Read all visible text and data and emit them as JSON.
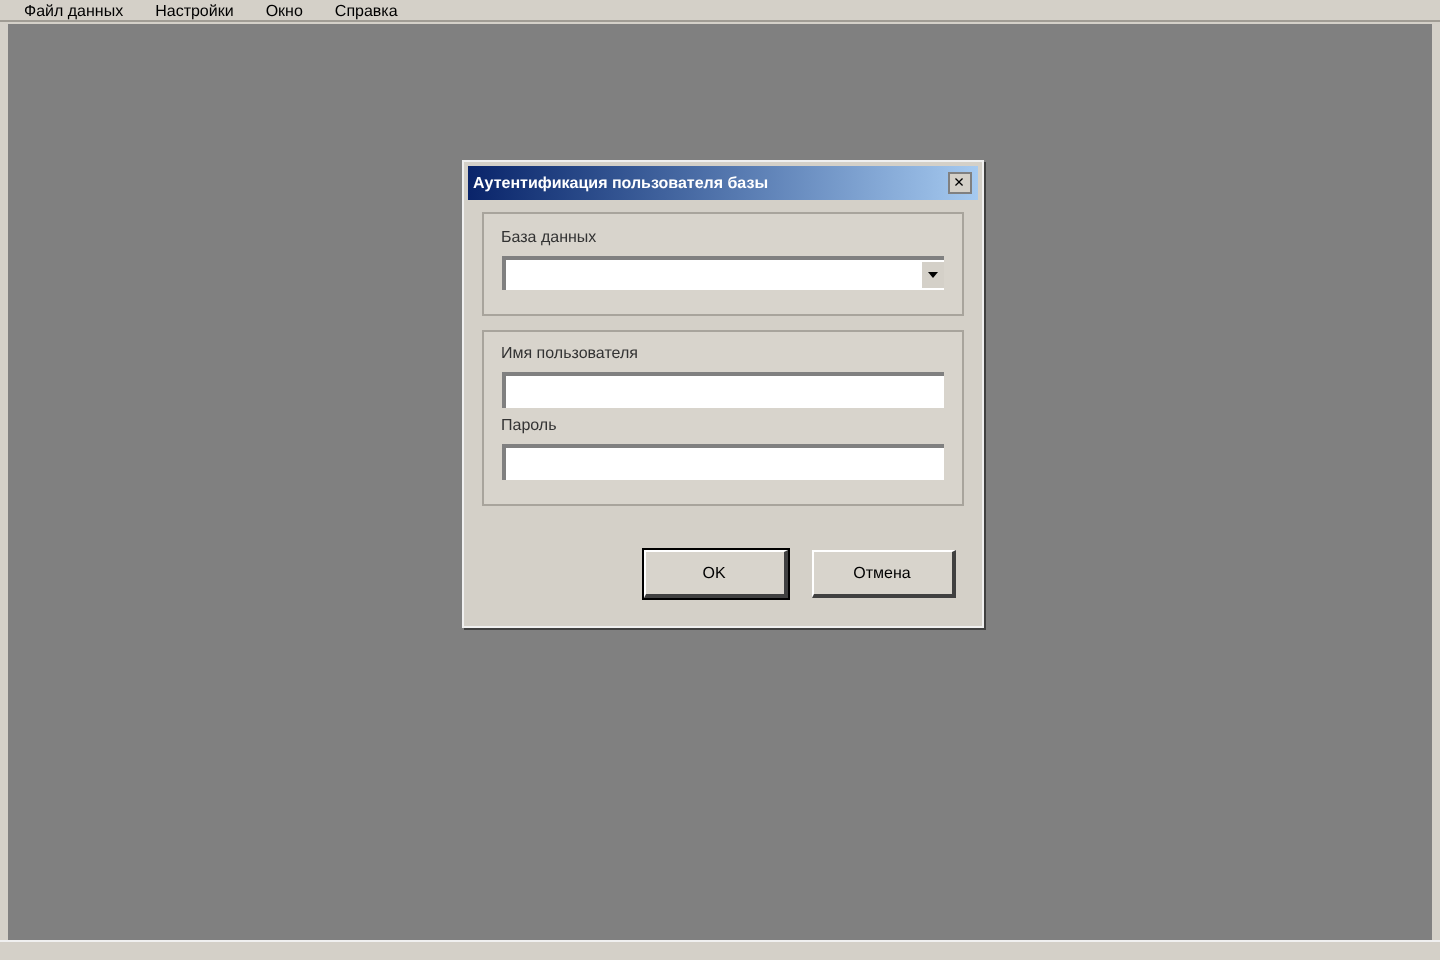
{
  "menu": [
    "Файл данных",
    "Настройки",
    "Окно",
    "Справка"
  ],
  "dialog": {
    "title": "Аутентификация пользователя базы",
    "close": "×",
    "database": {
      "label": "База данных"
    },
    "credentials": [
      {
        "label": "Имя пользователя"
      },
      {
        "label": "Пароль"
      }
    ],
    "buttons": [
      "OK",
      "Отмена"
    ]
  }
}
